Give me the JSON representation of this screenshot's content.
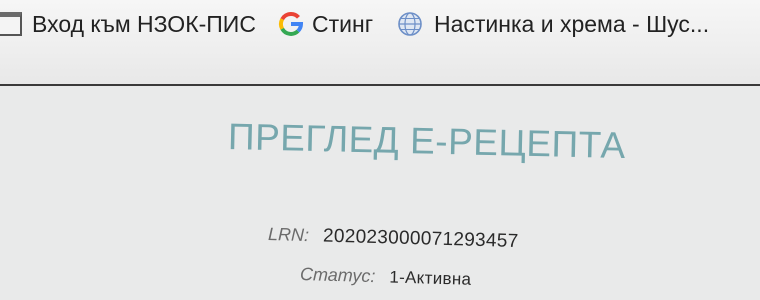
{
  "bookmarks": [
    {
      "label": "Вход към НЗОК-ПИС",
      "icon": "page-icon"
    },
    {
      "label": "Стинг",
      "icon": "google-icon",
      "glyph": "G"
    },
    {
      "label": "Настинка и хрема - Шус...",
      "icon": "globe-icon"
    }
  ],
  "page": {
    "title": "ПРЕГЛЕД Е-РЕЦЕПТА",
    "fields": {
      "lrn": {
        "label": "LRN:",
        "value": "202023000071293457"
      },
      "status": {
        "label": "Статус:",
        "value": "1-Активна"
      }
    }
  },
  "colors": {
    "title": "#76a7ad",
    "google_blue": "#4285f4",
    "google_red": "#ea4335",
    "google_yellow": "#fbbc05",
    "google_green": "#34a853",
    "globe": "#6d8fc7"
  }
}
